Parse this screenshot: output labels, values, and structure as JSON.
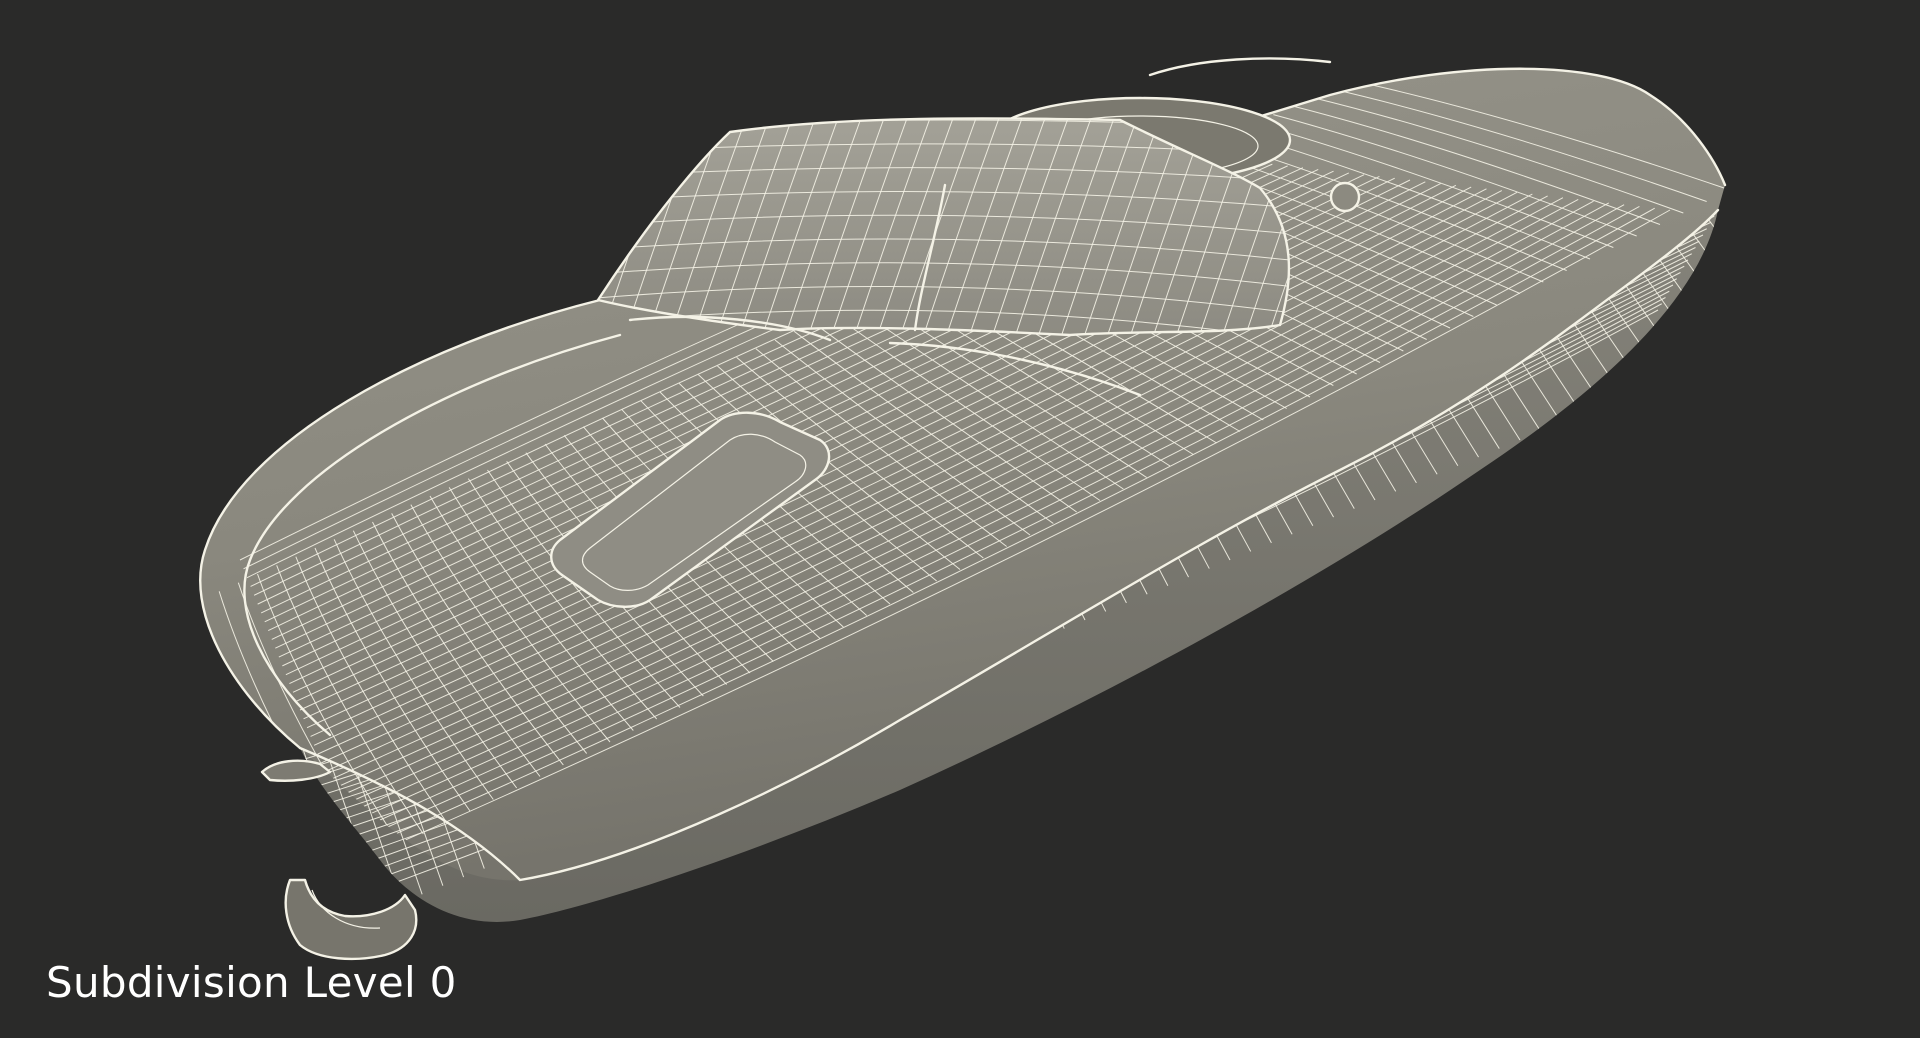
{
  "caption": "Subdivision Level 0",
  "colors": {
    "background": "#2a2a29",
    "hull": "#8c8a80",
    "hull_shadow": "#716f67",
    "hull_dark": "#5e5d57",
    "wire": "#f4f2e6",
    "caption": "#ffffff"
  },
  "model": {
    "name": "speedboat",
    "display_mode": "wireframe-on-shaded"
  }
}
